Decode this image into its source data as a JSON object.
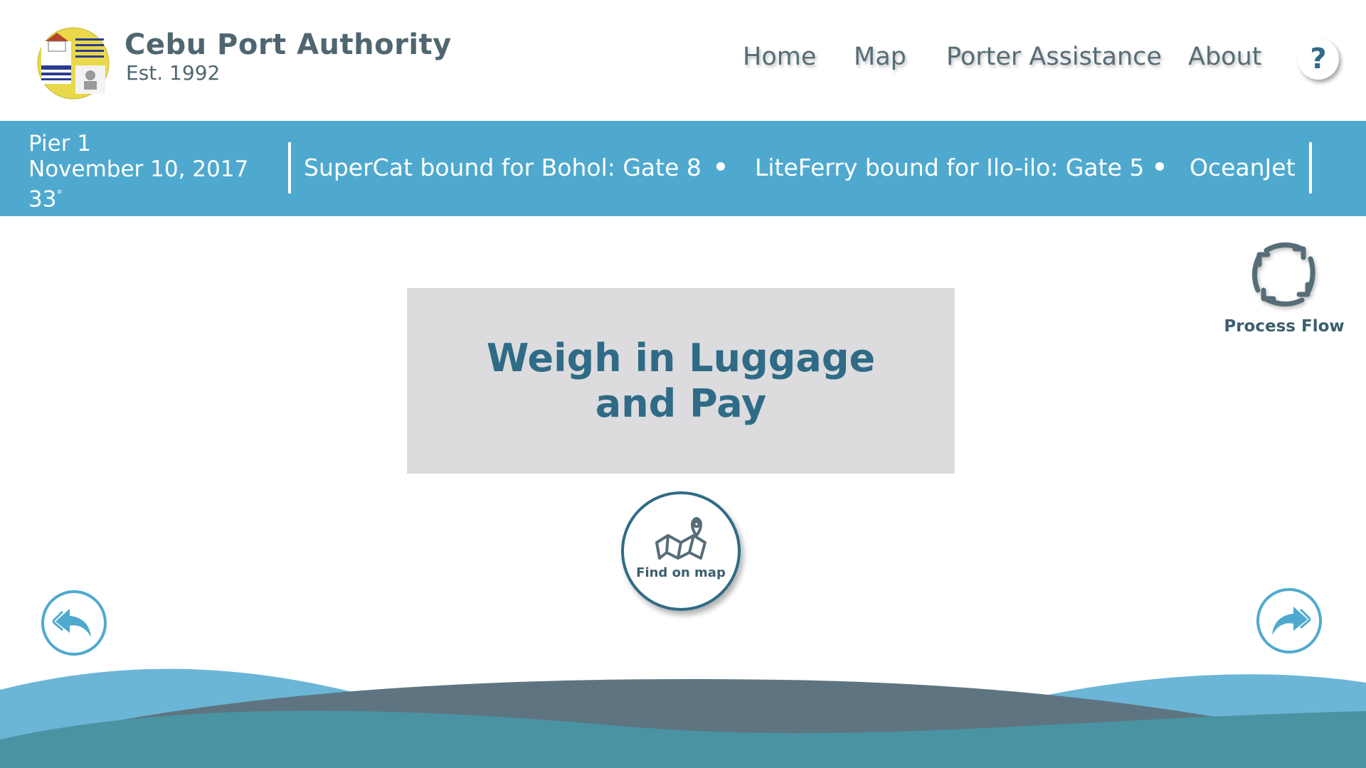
{
  "header": {
    "brand_title": "Cebu Port Authority",
    "brand_subtitle": "Est. 1992",
    "nav": {
      "home": "Home",
      "map": "Map",
      "porter": "Porter Assistance",
      "about": "About"
    },
    "help_label": "?"
  },
  "ticker": {
    "pier": "Pier 1",
    "date": "November 10, 2017",
    "temperature": "33",
    "degree_symbol": "°",
    "items": [
      "SuperCat bound for Bohol: Gate 8",
      "LiteFerry bound for Ilo-ilo: Gate 5",
      "OceanJet"
    ]
  },
  "process_flow": {
    "label": "Process Flow"
  },
  "step": {
    "title": "Weigh in Luggage and Pay"
  },
  "find_map": {
    "label": "Find on map"
  },
  "colors": {
    "accent_blue": "#4fa9cf",
    "dark_teal": "#2f6b86",
    "card_gray": "#dcdcde",
    "wave_light": "#6bb6d6",
    "wave_slate": "#5e7581",
    "wave_teal": "#4a93a3"
  },
  "icons": {
    "logo": "cebu-port-logo",
    "process_flow": "cycle-arrows-icon",
    "find_map": "map-pin-icon",
    "back": "reply-arrow-icon",
    "forward": "forward-arrow-icon"
  }
}
